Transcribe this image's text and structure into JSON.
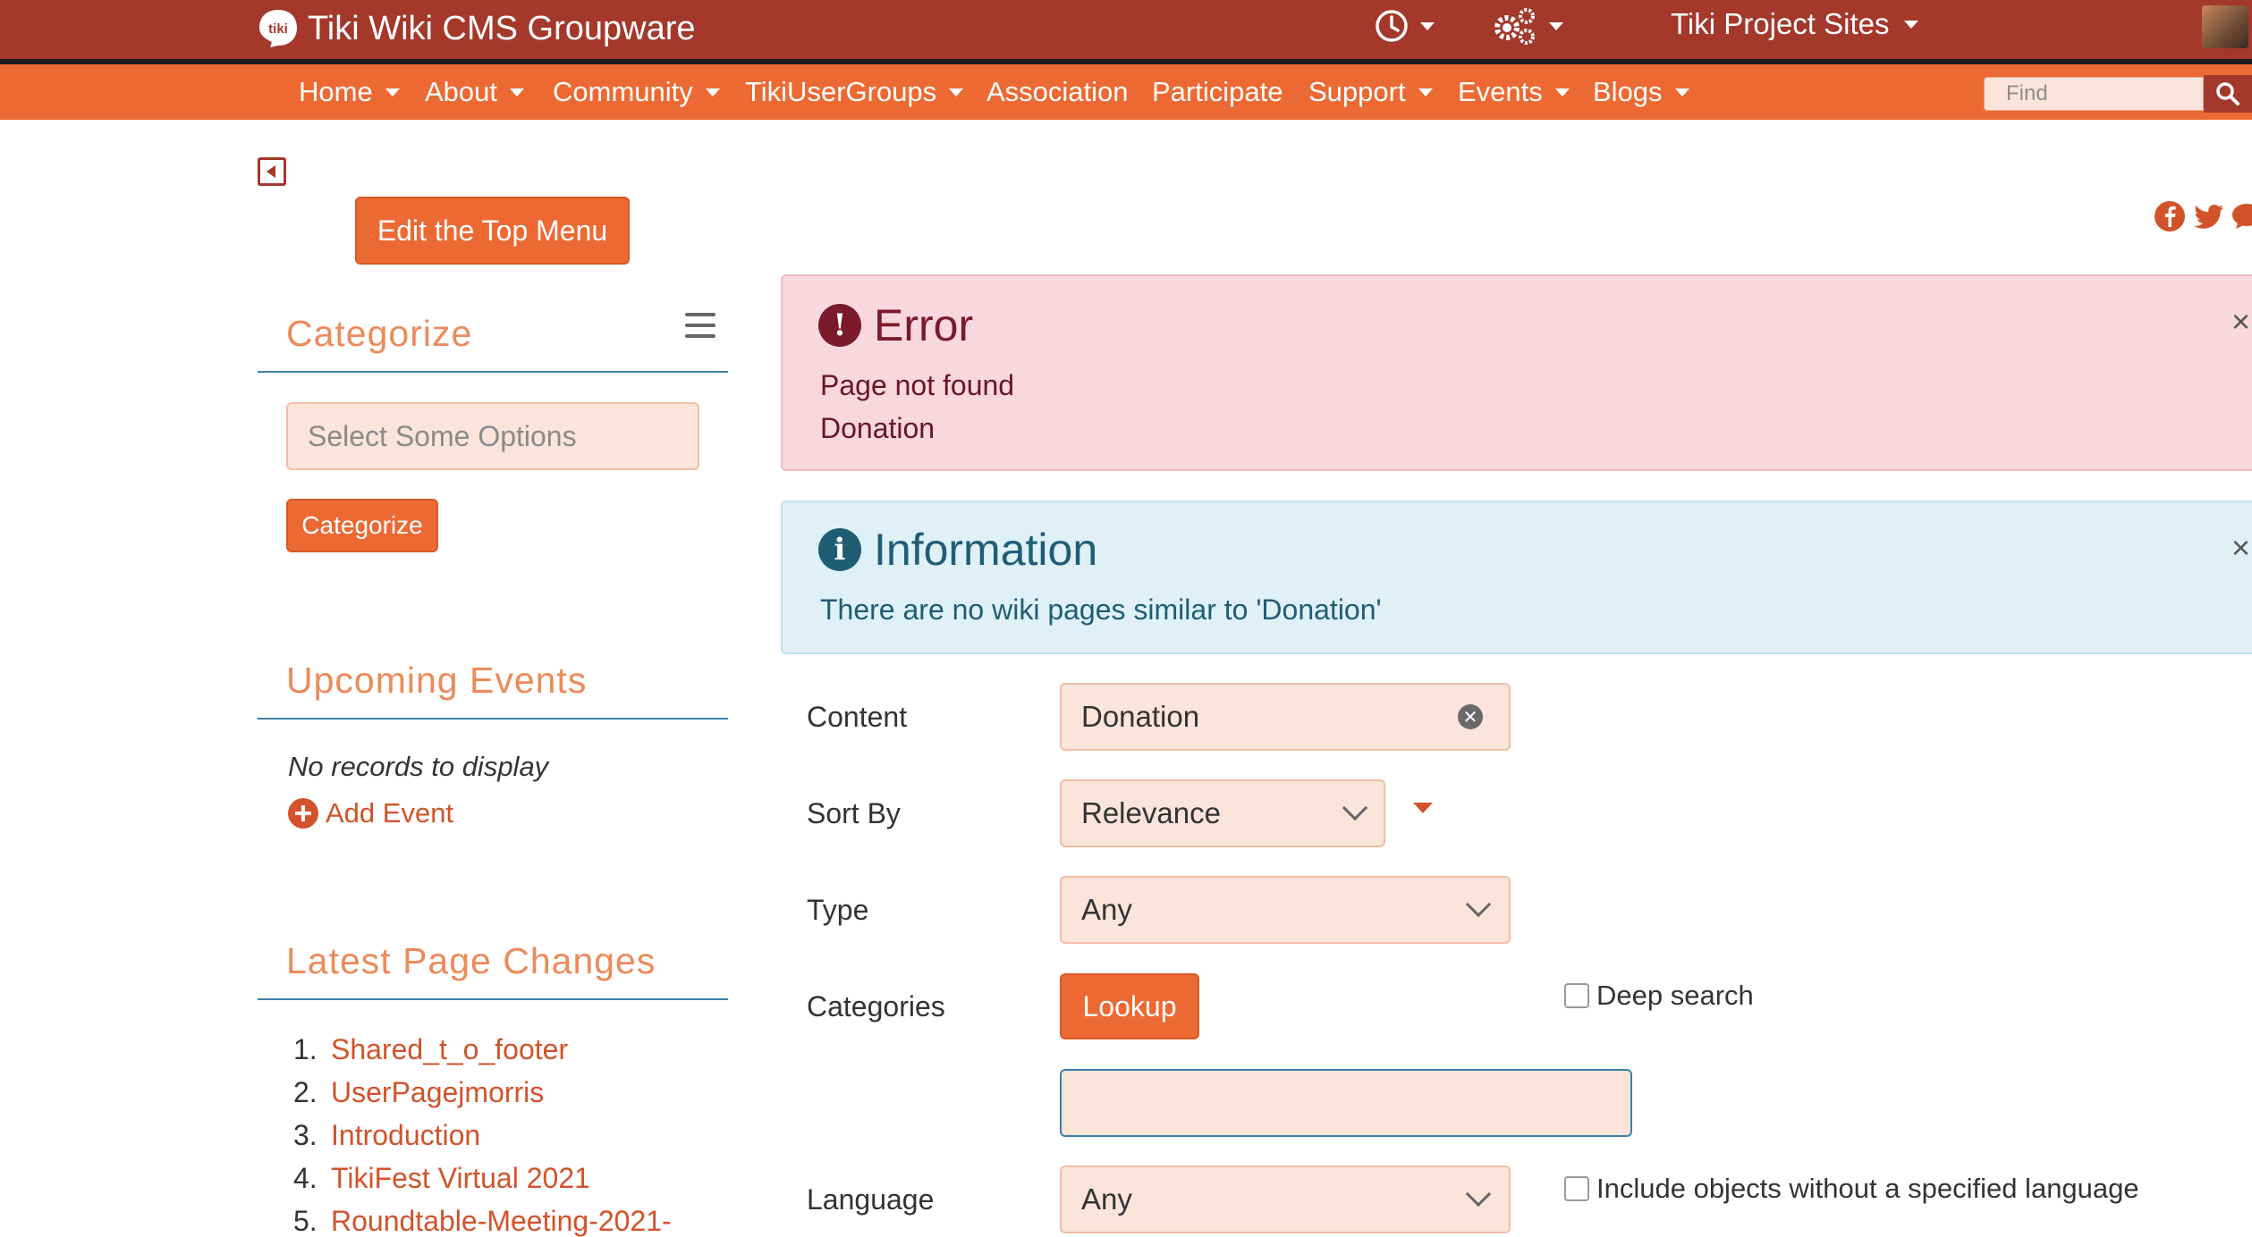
{
  "topbar": {
    "title": "Tiki Wiki CMS Groupware",
    "logo_text": "tiki",
    "history_icon": "clock-icon",
    "admin_icon": "gears-icon",
    "sites_label": "Tiki Project Sites"
  },
  "nav": {
    "items": [
      {
        "label": "Home",
        "dropdown": true
      },
      {
        "label": "About",
        "dropdown": true
      },
      {
        "label": "Community",
        "dropdown": true
      },
      {
        "label": "TikiUserGroups",
        "dropdown": true
      },
      {
        "label": "Association",
        "dropdown": false
      },
      {
        "label": "Participate",
        "dropdown": false
      },
      {
        "label": "Support",
        "dropdown": true
      },
      {
        "label": "Events",
        "dropdown": true
      },
      {
        "label": "Blogs",
        "dropdown": true
      }
    ],
    "search_placeholder": "Find"
  },
  "sidebar": {
    "edit_menu_button": "Edit the Top Menu",
    "categorize": {
      "title": "Categorize",
      "select_placeholder": "Select Some Options",
      "button": "Categorize"
    },
    "upcoming_events": {
      "title": "Upcoming Events",
      "empty": "No records to display",
      "add_event": "Add Event"
    },
    "latest_changes": {
      "title": "Latest Page Changes",
      "items": [
        {
          "num": "1.",
          "label": "Shared_t_o_footer"
        },
        {
          "num": "2.",
          "label": "UserPagejmorris"
        },
        {
          "num": "3.",
          "label": "Introduction"
        },
        {
          "num": "4.",
          "label": "TikiFest Virtual 2021"
        },
        {
          "num": "5.",
          "label": "Roundtable-Meeting-2021-"
        }
      ]
    }
  },
  "alerts": {
    "error": {
      "title": "Error",
      "line1": "Page not found",
      "line2": "Donation",
      "close": "×"
    },
    "info": {
      "title": "Information",
      "line1": "There are no wiki pages similar to 'Donation'",
      "close": "×"
    }
  },
  "form": {
    "content_label": "Content",
    "content_value": "Donation",
    "sort_label": "Sort By",
    "sort_value": "Relevance",
    "type_label": "Type",
    "type_value": "Any",
    "categories_label": "Categories",
    "lookup_button": "Lookup",
    "deep_search_label": "Deep search",
    "language_label": "Language",
    "language_value": "Any",
    "include_label": "Include objects without a specified language"
  },
  "colors": {
    "topbar": "#a3382b",
    "navbar": "#ec6933",
    "accent": "#d2522a",
    "error_bg": "#f8d7df",
    "info_bg": "#dff0f7"
  }
}
